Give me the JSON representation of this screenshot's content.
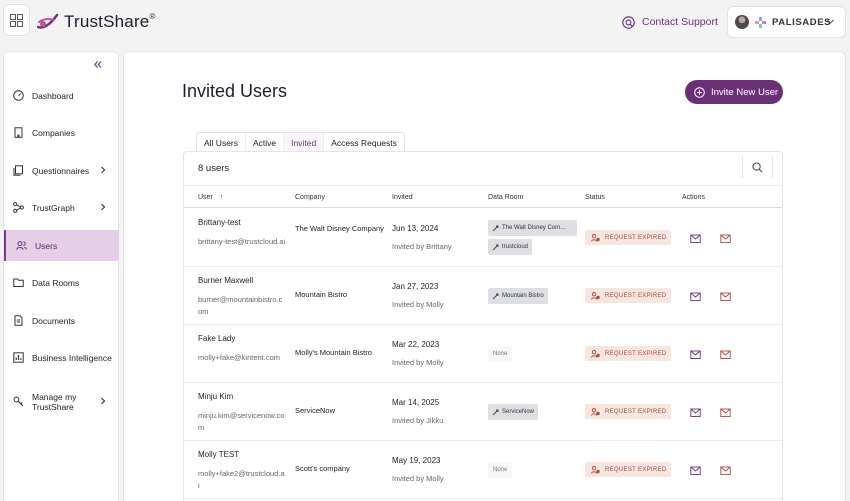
{
  "header": {
    "brand": "TrustShare",
    "brand_mark": "®",
    "contact_support": "Contact Support",
    "org_name": "PALISADES"
  },
  "sidebar": {
    "items": [
      {
        "label": "Dashboard",
        "icon": "dashboard-icon"
      },
      {
        "label": "Companies",
        "icon": "building-icon"
      },
      {
        "label": "Questionnaires",
        "icon": "questionnaire-icon",
        "has_submenu": true
      },
      {
        "label": "TrustGraph",
        "icon": "graph-icon",
        "has_submenu": true
      },
      {
        "label": "Users",
        "icon": "users-icon",
        "active": true
      },
      {
        "label": "Data Rooms",
        "icon": "folder-icon"
      },
      {
        "label": "Documents",
        "icon": "document-icon"
      },
      {
        "label": "Business Intelligence",
        "icon": "chart-icon"
      },
      {
        "label_line1": "Manage my",
        "label_line2": "TrustShare",
        "icon": "settings-icon",
        "has_submenu": true
      }
    ]
  },
  "main": {
    "title": "Invited Users",
    "invite_button": "Invite New User",
    "tabs": [
      {
        "label": "All Users"
      },
      {
        "label": "Active"
      },
      {
        "label": "Invited",
        "active": true
      },
      {
        "label": "Access Requests"
      }
    ],
    "count": "8 users",
    "columns": {
      "user": "User",
      "sort_indicator": "↑",
      "company": "Company",
      "invited": "Invited",
      "data_room": "Data Room",
      "status": "Status",
      "actions": "Actions"
    },
    "rows": [
      {
        "name": "Brittany-test",
        "email": "brittany-test@trustcloud.ai",
        "company": "The Walt Disney Company",
        "date": "Jun 13, 2024",
        "invited_by": "Invited by Brittany",
        "data_rooms": [
          "The Walt Disney Com…",
          "trustcloud"
        ],
        "status": "REQUEST EXPIRED"
      },
      {
        "name": "Burner Maxwell",
        "email": "burner@mountainbistro.com",
        "company": "Mountain Bistro",
        "date": "Jan 27, 2023",
        "invited_by": "Invited by Molly",
        "data_rooms": [
          "Mountain Bistro"
        ],
        "status": "REQUEST EXPIRED"
      },
      {
        "name": "Fake Lady",
        "email": "molly+fake@kintent.com",
        "company": "Molly's Mountain Bistro",
        "date": "Mar 22, 2023",
        "invited_by": "Invited by Molly",
        "data_rooms": [],
        "data_room_none": "None",
        "status": "REQUEST EXPIRED"
      },
      {
        "name": "Minju Kim",
        "email": "minju.kim@servicenow.com",
        "company": "ServiceNow",
        "date": "Mar 14, 2025",
        "invited_by": "Invited by Jikku",
        "data_rooms": [
          "ServiceNow"
        ],
        "status": "REQUEST EXPIRED"
      },
      {
        "name": "Molly TEST",
        "email": "molly+fake2@trustcloud.ai",
        "company": "Scott's company",
        "date": "May 19, 2023",
        "invited_by": "Invited by Molly",
        "data_rooms": [],
        "data_room_none": "None",
        "status": "REQUEST EXPIRED"
      }
    ]
  },
  "colors": {
    "accent": "#6b2f78",
    "active_nav_bg": "#e6cfe6",
    "status_bg": "#f6e6e0",
    "status_text": "#b0473a"
  }
}
